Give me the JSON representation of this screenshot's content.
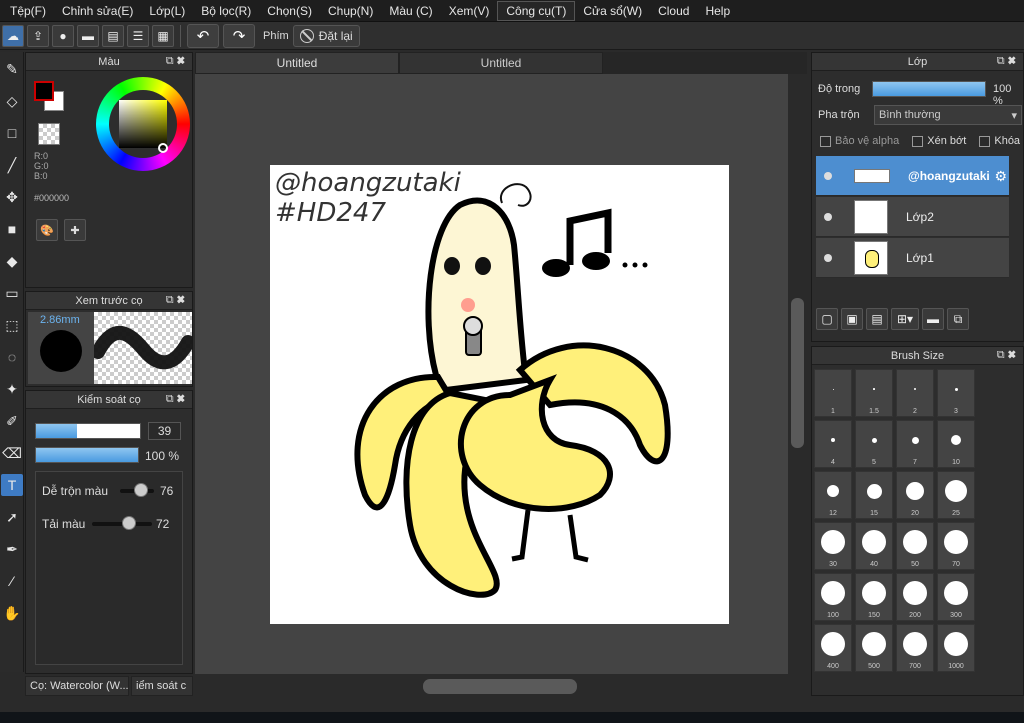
{
  "menu": [
    "Tệp(F)",
    "Chỉnh sửa(E)",
    "Lớp(L)",
    "Bộ lọc(R)",
    "Chọn(S)",
    "Chụp(N)",
    "Màu (C)",
    "Xem(V)",
    "Công cụ(T)",
    "Cửa sổ(W)",
    "Cloud",
    "Help"
  ],
  "toolbar": {
    "key_label": "Phím",
    "reset_label": "Đặt lại",
    "undo_icon": "undo-arrow-icon",
    "redo_icon": "redo-arrow-icon"
  },
  "color_panel": {
    "title": "Màu",
    "r": "R:0",
    "g": "G:0",
    "b": "B:0",
    "hex": "#000000",
    "fg_color": "#000000",
    "bg_color": "#ffffff"
  },
  "brush_preview": {
    "title": "Xem trước cọ",
    "size": "2.86mm"
  },
  "brush_control": {
    "title": "Kiểm soát cọ",
    "size_value": "39",
    "size_fraction": 0.39,
    "opacity_value": "100 %",
    "opacity_fraction": 1.0,
    "blend_label": "Dễ trộn màu",
    "blend_value": "76",
    "amount_label": "Tải màu",
    "amount_value": "72"
  },
  "bottom_tabs": {
    "brush": "Cọ: Watercolor (W...",
    "control": "iểm soát c"
  },
  "doc_tabs": [
    "Untitled",
    "Untitled"
  ],
  "canvas_text": {
    "line1": "@hoangzutaki",
    "line2": "#HD247"
  },
  "layers_panel": {
    "title": "Lớp",
    "opacity_label": "Độ trong",
    "opacity_value": "100 %",
    "blend_label": "Pha trộn",
    "blend_value": "Bình thường",
    "protect_alpha": "Bảo vệ alpha",
    "clip": "Xén bớt",
    "lock": "Khóa",
    "layers": [
      {
        "name": "@hoangzutaki",
        "selected": true
      },
      {
        "name": "Lớp2",
        "selected": false
      },
      {
        "name": "Lớp1",
        "selected": false
      }
    ]
  },
  "brush_size_panel": {
    "title": "Brush Size",
    "sizes": [
      "1",
      "1.5",
      "2",
      "3",
      "4",
      "5",
      "7",
      "10",
      "12",
      "15",
      "20",
      "25",
      "30",
      "40",
      "50",
      "70",
      "100",
      "150",
      "200",
      "300",
      "400",
      "500",
      "700",
      "1000"
    ]
  },
  "colors": {
    "accent": "#4d8ed0",
    "banana_yellow": "#fff07a",
    "banana_cream": "#fdf6d4"
  }
}
